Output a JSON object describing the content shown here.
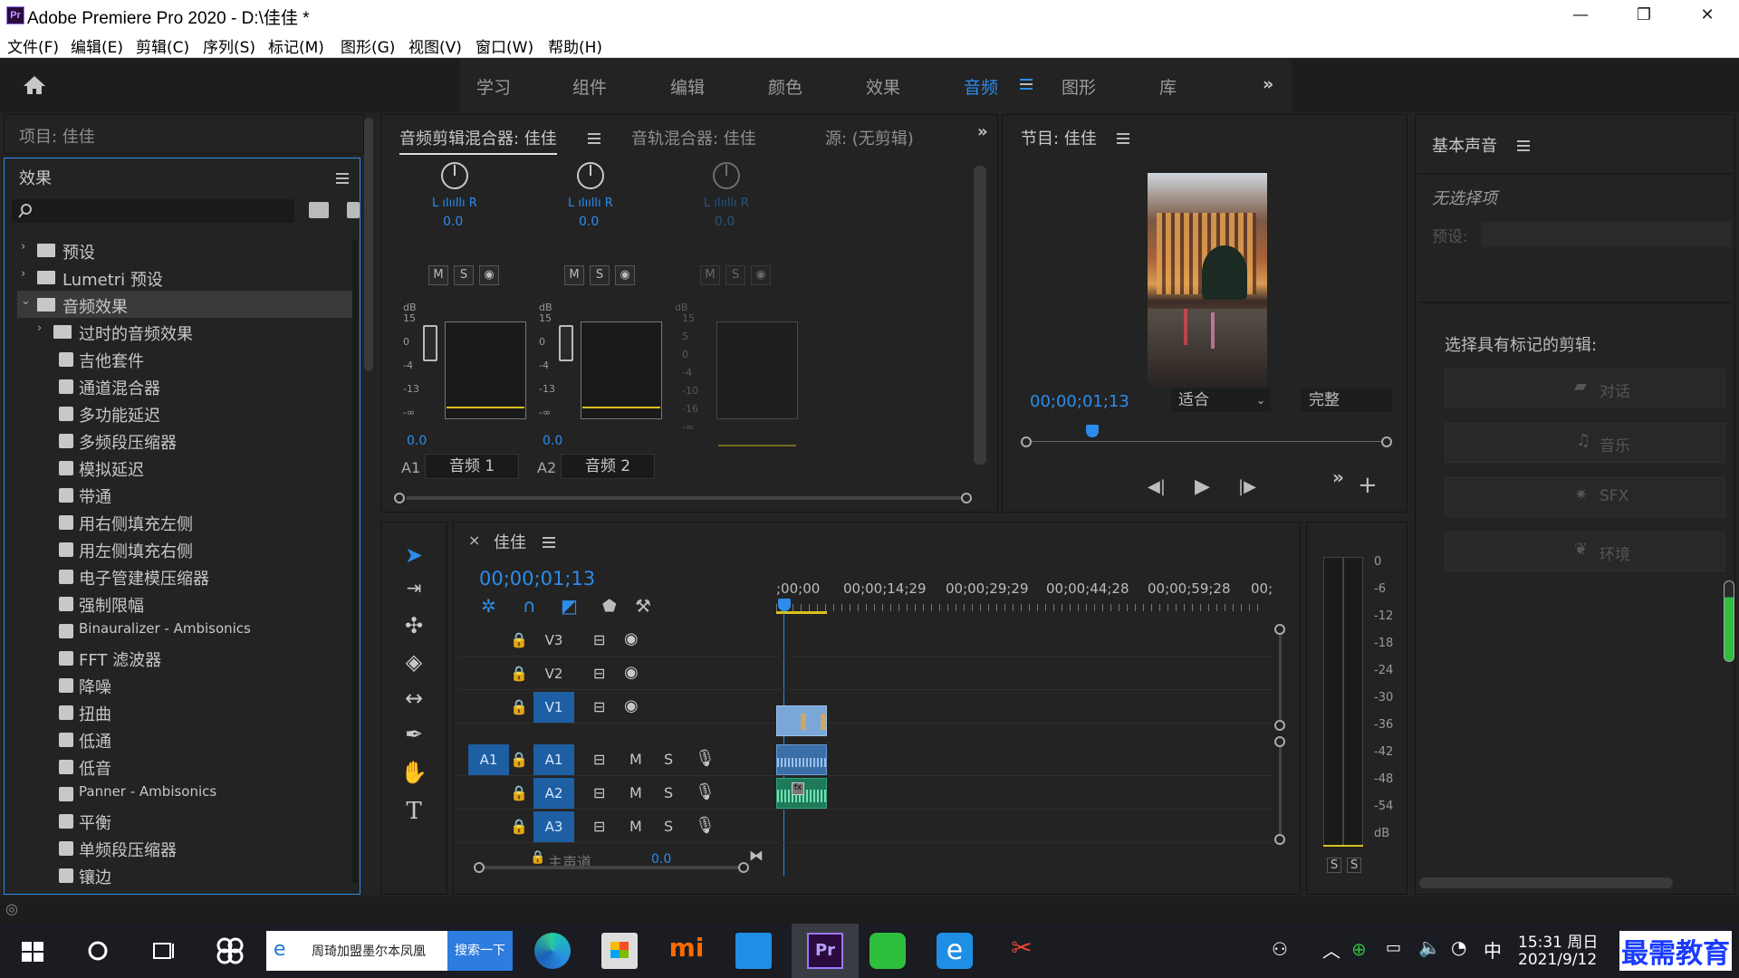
{
  "window": {
    "title": "Adobe Premiere Pro 2020 - D:\\佳佳 *",
    "app_icon": "Pr",
    "minimize": "—",
    "restore": "❐",
    "close": "✕"
  },
  "menu": [
    "文件(F)",
    "编辑(E)",
    "剪辑(C)",
    "序列(S)",
    "标记(M)",
    "图形(G)",
    "视图(V)",
    "窗口(W)",
    "帮助(H)"
  ],
  "workspaces": {
    "tabs": [
      "学习",
      "组件",
      "编辑",
      "颜色",
      "效果",
      "音频",
      "图形",
      "库"
    ],
    "active": "音频",
    "more": "»"
  },
  "project_panel": {
    "title": "项目: 佳佳"
  },
  "effects_panel": {
    "title": "效果",
    "search_placeholder": "",
    "items": [
      {
        "label": "预设",
        "kind": "folder",
        "level": 0,
        "chev": "›"
      },
      {
        "label": "Lumetri 预设",
        "kind": "folder",
        "level": 0,
        "chev": "›"
      },
      {
        "label": "音频效果",
        "kind": "folder",
        "level": 0,
        "chev": "⌄",
        "selected": true
      },
      {
        "label": "过时的音频效果",
        "kind": "folder",
        "level": 1,
        "chev": "›"
      },
      {
        "label": "吉他套件",
        "kind": "fx",
        "level": 1
      },
      {
        "label": "通道混合器",
        "kind": "fx",
        "level": 1
      },
      {
        "label": "多功能延迟",
        "kind": "fx",
        "level": 1
      },
      {
        "label": "多频段压缩器",
        "kind": "fx",
        "level": 1
      },
      {
        "label": "模拟延迟",
        "kind": "fx",
        "level": 1
      },
      {
        "label": "带通",
        "kind": "fx",
        "level": 1
      },
      {
        "label": "用右侧填充左侧",
        "kind": "fx",
        "level": 1
      },
      {
        "label": "用左侧填充右侧",
        "kind": "fx",
        "level": 1
      },
      {
        "label": "电子管建模压缩器",
        "kind": "fx",
        "level": 1
      },
      {
        "label": "强制限幅",
        "kind": "fx",
        "level": 1
      },
      {
        "label": "Binauralizer - Ambisonics",
        "kind": "fx",
        "level": 1
      },
      {
        "label": "FFT 滤波器",
        "kind": "fx",
        "level": 1
      },
      {
        "label": "降噪",
        "kind": "fx",
        "level": 1
      },
      {
        "label": "扭曲",
        "kind": "fx",
        "level": 1
      },
      {
        "label": "低通",
        "kind": "fx",
        "level": 1
      },
      {
        "label": "低音",
        "kind": "fx",
        "level": 1
      },
      {
        "label": "Panner - Ambisonics",
        "kind": "fx",
        "level": 1
      },
      {
        "label": "平衡",
        "kind": "fx",
        "level": 1
      },
      {
        "label": "单频段压缩器",
        "kind": "fx",
        "level": 1
      },
      {
        "label": "镶边",
        "kind": "fx",
        "level": 1
      }
    ]
  },
  "mixer": {
    "tabs": [
      "音频剪辑混合器: 佳佳",
      "音轨混合器: 佳佳",
      "源: (无剪辑)"
    ],
    "channels": [
      {
        "lr": "L ılııllı R",
        "value": "0.0",
        "btns": [
          "M",
          "S",
          "◉"
        ],
        "db": "dB",
        "scale": [
          "15",
          "0",
          "-4",
          "-13",
          "-∞"
        ],
        "fader_val": "0.0",
        "track": "A1",
        "name": "音频 1"
      },
      {
        "lr": "L ılııllı R",
        "value": "0.0",
        "btns": [
          "M",
          "S",
          "◉"
        ],
        "db": "dB",
        "scale": [
          "15",
          "0",
          "-4",
          "-13",
          "-∞"
        ],
        "fader_val": "0.0",
        "track": "A2",
        "name": "音频 2"
      },
      {
        "lr": "L ılııllı R",
        "value": "0.0",
        "btns": [
          "M",
          "S",
          "◉"
        ],
        "db": "dB",
        "scale": [
          "15",
          "5",
          "0",
          "-4",
          "-10",
          "-16",
          "-∞"
        ],
        "fader_val": "",
        "track": "",
        "name": ""
      }
    ]
  },
  "program_monitor": {
    "title": "节目: 佳佳",
    "timecode": "00;00;01;13",
    "fit": "适合",
    "quality": "完整",
    "controls": {
      "back": "◀|",
      "play": "▶",
      "fwd": "|▶",
      "more": "»",
      "add": "+"
    }
  },
  "essential_sound": {
    "title": "基本声音",
    "no_selection": "无选择项",
    "preset_label": "预设:",
    "select_prompt": "选择具有标记的剪辑:",
    "types": [
      "对话",
      "音乐",
      "SFX",
      "环境"
    ]
  },
  "timeline": {
    "close": "×",
    "title": "佳佳",
    "timecode": "00;00;01;13",
    "ruler": [
      ";00;00",
      "00;00;14;29",
      "00;00;29;29",
      "00;00;44;28",
      "00;00;59;28",
      "00;"
    ],
    "video_tracks": [
      "V3",
      "V2",
      "V1"
    ],
    "audio_tracks": [
      "A1",
      "A2",
      "A3"
    ],
    "source_patch": "A1",
    "master_label": "主声道",
    "master_value": "0.0",
    "track_btn_m": "M",
    "track_btn_s": "S"
  },
  "audio_meter": {
    "scale": [
      "0",
      "-6",
      "-12",
      "-18",
      "-24",
      "-30",
      "-36",
      "-42",
      "-48",
      "-54",
      "dB"
    ],
    "solo": [
      "S",
      "S"
    ]
  },
  "taskbar": {
    "search_text": "周琦加盟墨尔本凤凰",
    "search_button": "搜索一下",
    "time": "15:31 周日",
    "date": "2021/9/12",
    "ime": "中",
    "watermark": "最需教育"
  },
  "colors": {
    "accent": "#2d8ceb",
    "track_badge": "#1e5fa3",
    "meter_yellow": "#d8c21f",
    "clip_video": "#7aa7d8",
    "clip_audio": "#2fa37a"
  }
}
